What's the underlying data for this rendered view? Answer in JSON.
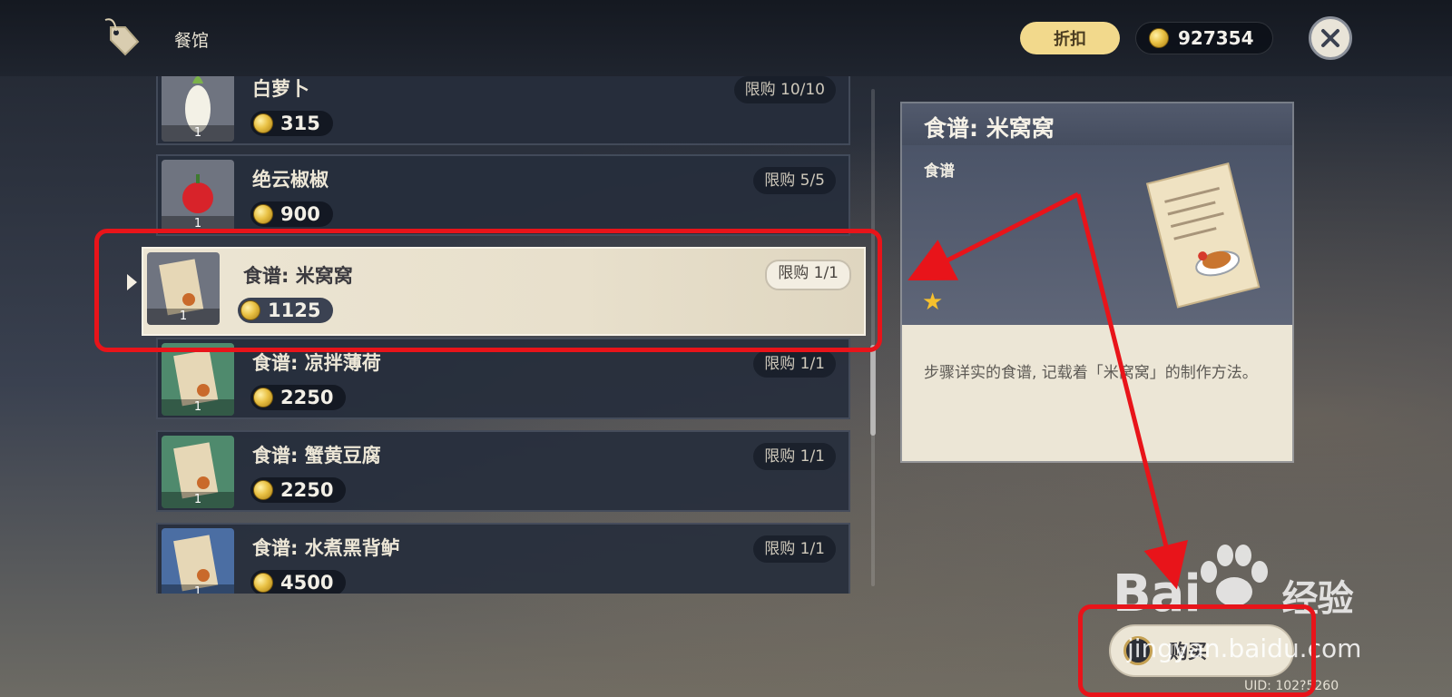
{
  "header": {
    "shop_title": "餐馆",
    "discount_label": "折扣",
    "currency_amount": "927354"
  },
  "shop_items": [
    {
      "name": "白萝卜",
      "price": "315",
      "limit": "限购 10/10",
      "qty": "1",
      "thumb_bg": "#6f7480"
    },
    {
      "name": "绝云椒椒",
      "price": "900",
      "limit": "限购 5/5",
      "qty": "1",
      "thumb_bg": "#6f7480"
    },
    {
      "name": "食谱: 米窝窝",
      "price": "1125",
      "limit": "限购 1/1",
      "qty": "1",
      "thumb_bg": "#6f7480",
      "selected": true
    },
    {
      "name": "食谱: 凉拌薄荷",
      "price": "2250",
      "limit": "限购 1/1",
      "qty": "1",
      "thumb_bg": "#4f8a6d"
    },
    {
      "name": "食谱: 蟹黄豆腐",
      "price": "2250",
      "limit": "限购 1/1",
      "qty": "1",
      "thumb_bg": "#4f8a6d"
    },
    {
      "name": "食谱: 水煮黑背鲈",
      "price": "4500",
      "limit": "限购 1/1",
      "qty": "1",
      "thumb_bg": "#4b6ea3"
    }
  ],
  "detail": {
    "title": "食谱: 米窝窝",
    "type": "食谱",
    "rarity": 1,
    "description": "步骤详实的食谱, 记载着「米窝窝」的制作方法。"
  },
  "buy_button": {
    "label": "购买"
  },
  "uid_text": "UID: 102?5260",
  "watermark": {
    "logo_text": "Bai",
    "logo_suffix": "经验",
    "sub_text": "jingyan.baidu.com"
  },
  "colors": {
    "annotation_red": "#e8141a",
    "coin_gold": "#e9c144",
    "panel_cream": "#ece6d6"
  },
  "icons": [
    "price-tag-icon",
    "coin-icon",
    "close-icon",
    "star-icon",
    "recipe-scroll-icon",
    "buy-coin-icon"
  ]
}
